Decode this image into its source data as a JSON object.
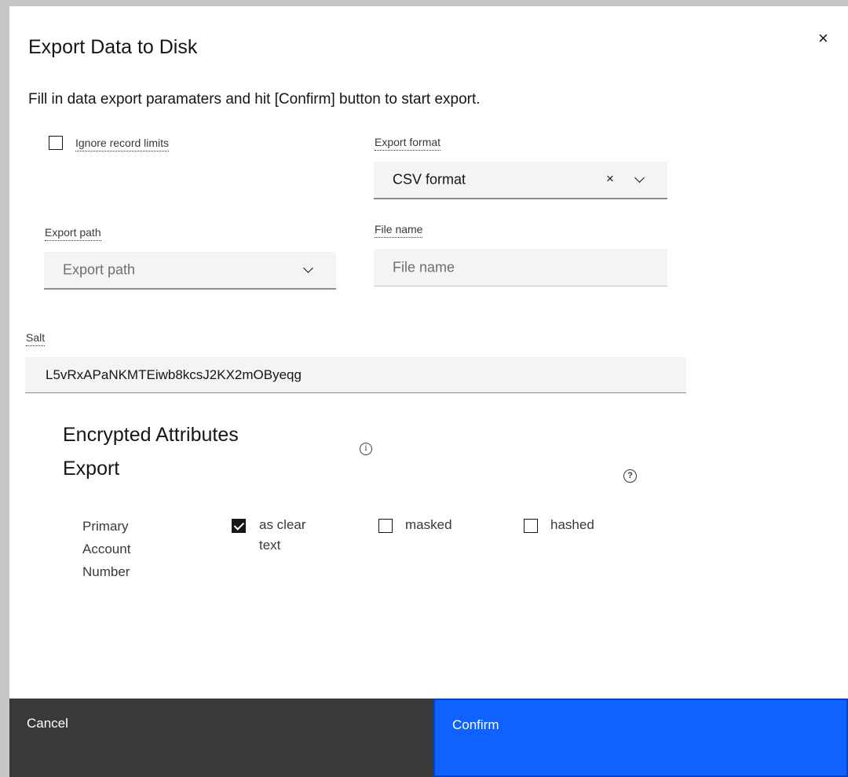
{
  "dialog": {
    "title": "Export Data to Disk",
    "description": "Fill in data export paramaters and hit [Confirm] button to start export.",
    "close_icon": "×"
  },
  "ignore_limits": {
    "label": "Ignore record limits",
    "checked": false
  },
  "export_format": {
    "label": "Export format",
    "value": "CSV format"
  },
  "export_path": {
    "label": "Export path",
    "placeholder": "Export path"
  },
  "file_name": {
    "label": "File name",
    "placeholder": "File name"
  },
  "salt": {
    "label": "Salt",
    "value": "L5vRxAPaNKMTEiwb8kcsJ2KX2mOByeqg"
  },
  "encrypted": {
    "title_line1": "Encrypted Attributes",
    "title_line2": "Export",
    "attribute": {
      "line1": "Primary",
      "line2": "Account",
      "line3": "Number"
    },
    "options": [
      {
        "line1": "as clear",
        "line2": "text",
        "checked": true
      },
      {
        "line1": "masked",
        "checked": false
      },
      {
        "line1": "hashed",
        "checked": false
      }
    ]
  },
  "footer": {
    "cancel_label": "Cancel",
    "confirm_label": "Confirm"
  },
  "colors": {
    "primary": "#0f62fe",
    "secondary": "#393939"
  }
}
